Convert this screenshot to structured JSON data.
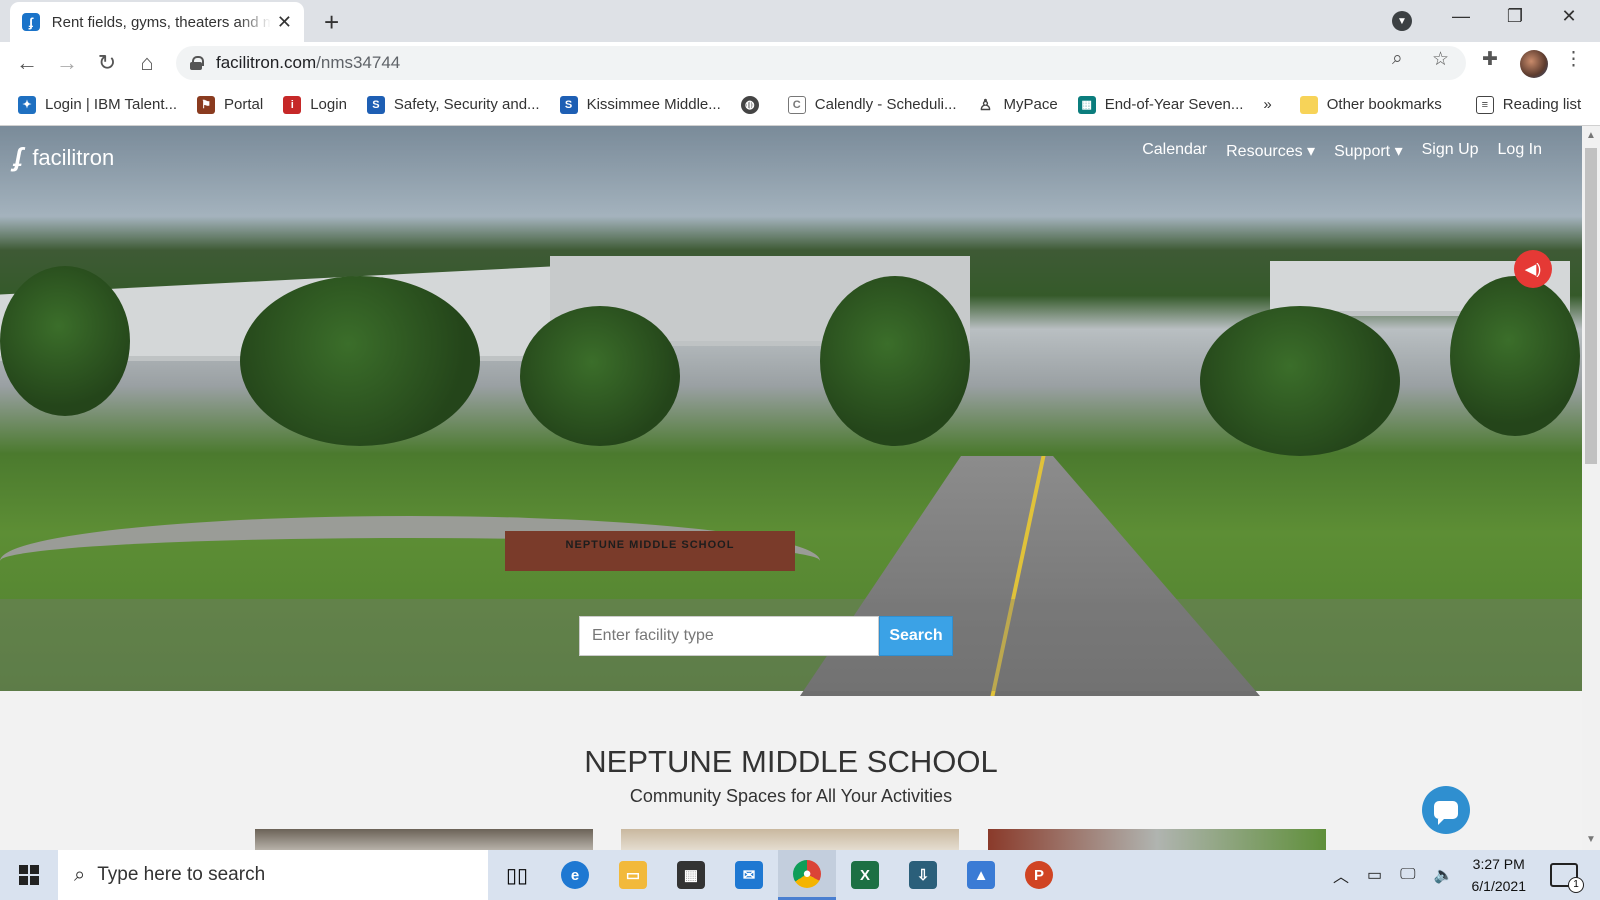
{
  "browser": {
    "tab_title": "Rent fields, gyms, theaters and more",
    "url_host": "facilitron.com",
    "url_path": "/nms34744",
    "bookmarks": [
      {
        "label": "Login | IBM Talent...",
        "color": "#1f70c1",
        "glyph": "✦"
      },
      {
        "label": "Portal",
        "color": "#8a3b1f",
        "glyph": "⚑"
      },
      {
        "label": "Login",
        "color": "#c62828",
        "glyph": "i"
      },
      {
        "label": "Safety, Security and...",
        "color": "#1e5fb4",
        "glyph": "S"
      },
      {
        "label": "Kissimmee Middle...",
        "color": "#1e5fb4",
        "glyph": "S"
      },
      {
        "label": "",
        "color": "#444444",
        "glyph": "◍"
      },
      {
        "label": "Calendly - Scheduli...",
        "color": "#777777",
        "glyph": "C"
      },
      {
        "label": "MyPace",
        "color": "#444444",
        "glyph": "♙"
      },
      {
        "label": "End-of-Year Seven...",
        "color": "#0b7d7d",
        "glyph": "▦"
      }
    ],
    "more_bookmarks": "»",
    "other_bookmarks": "Other bookmarks",
    "reading_list": "Reading list"
  },
  "site": {
    "logo": "facilitron",
    "nav": [
      "Calendar",
      "Resources ▾",
      "Support ▾",
      "Sign Up",
      "Log In"
    ],
    "search_placeholder": "Enter facility type",
    "search_button": "Search",
    "school_sign": "NEPTUNE MIDDLE SCHOOL",
    "school_name": "NEPTUNE MIDDLE SCHOOL",
    "tagline": "Community Spaces for All Your Activities"
  },
  "taskbar": {
    "search_text": "Type here to search",
    "time": "3:27 PM",
    "date": "6/1/2021",
    "notification_count": "1"
  }
}
